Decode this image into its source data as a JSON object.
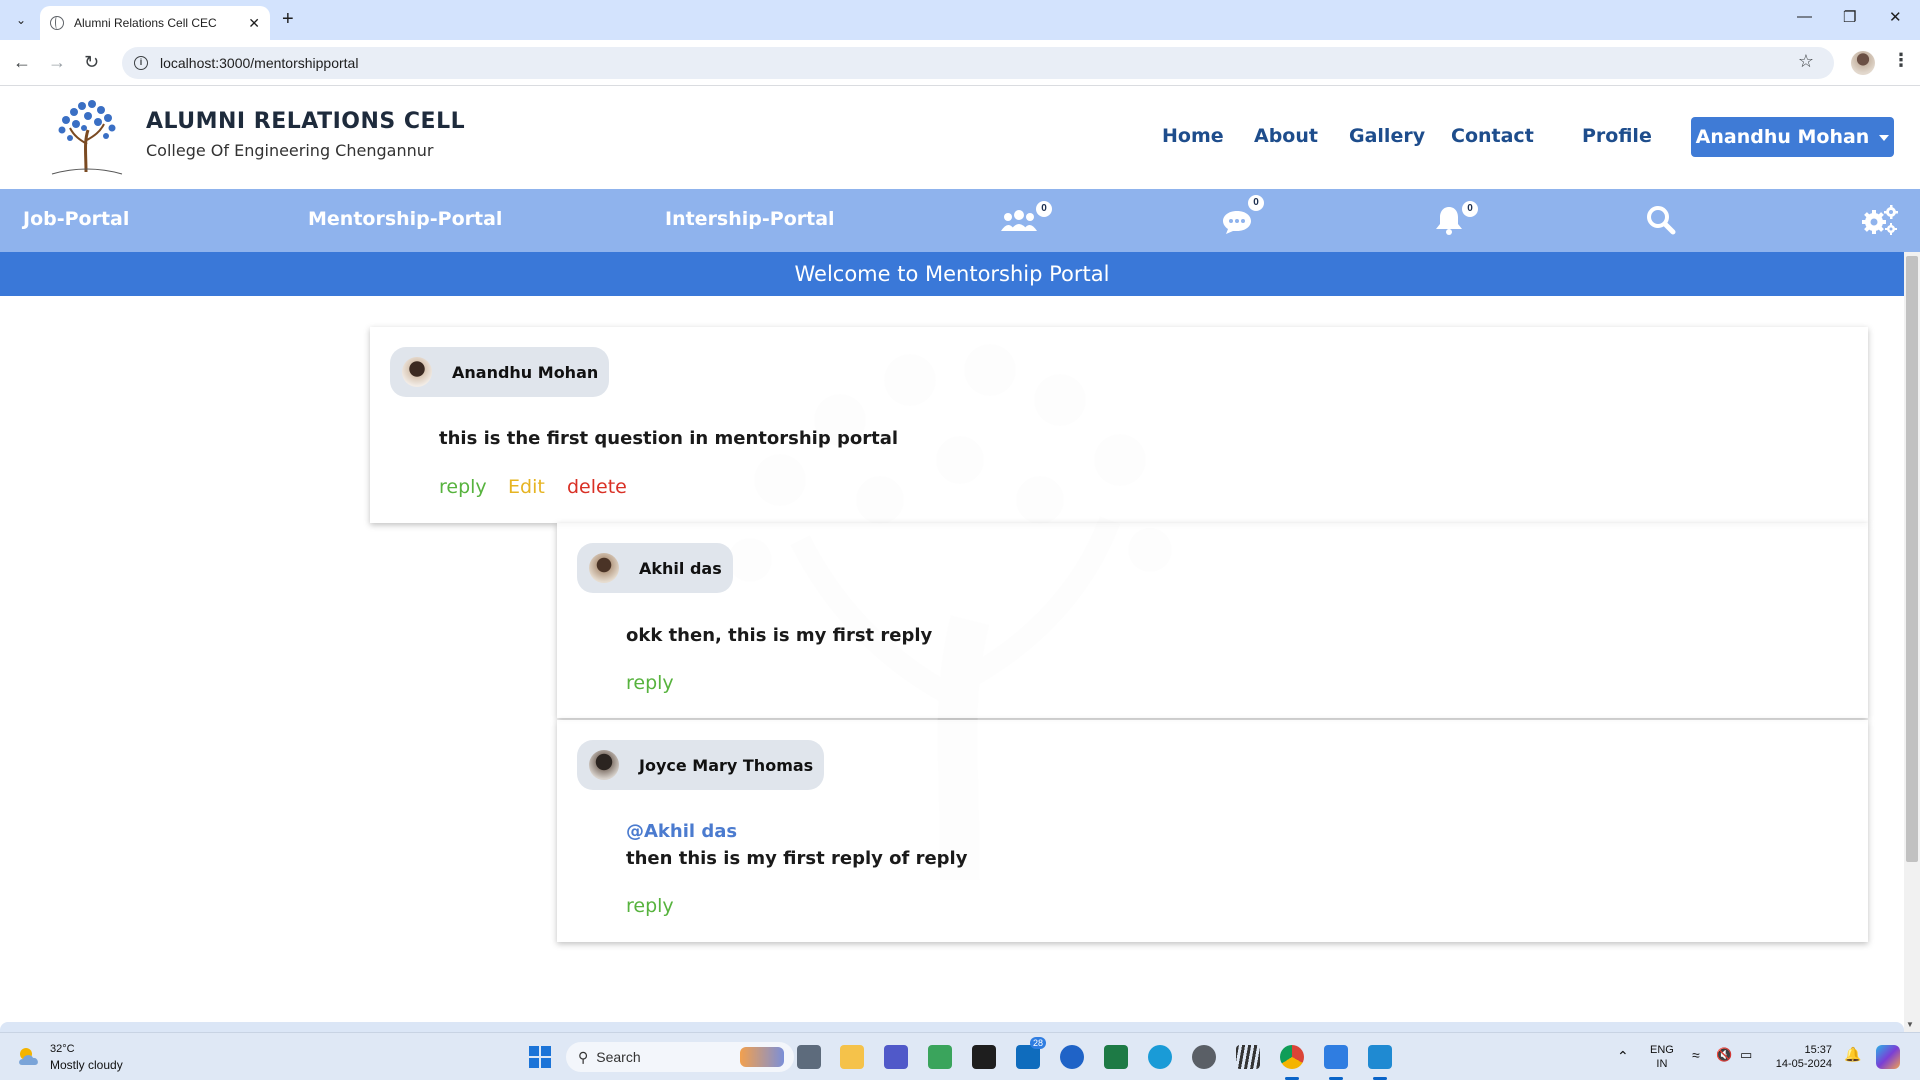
{
  "browser": {
    "tab_title": "Alumni Relations Cell CEC",
    "url": "localhost:3000/mentorshipportal"
  },
  "header": {
    "title": "ALUMNI RELATIONS CELL",
    "subtitle": "College Of Engineering Chengannur",
    "nav": [
      "Home",
      "About",
      "Gallery",
      "Contact",
      "Profile"
    ],
    "user": "Anandhu Mohan"
  },
  "subnav": {
    "links": [
      "Job-Portal",
      "Mentorship-Portal",
      "Intership-Portal"
    ],
    "badges": {
      "groups": "0",
      "messages": "0",
      "notifications": "0"
    }
  },
  "welcome": "Welcome to Mentorship Portal",
  "posts": [
    {
      "author": "Anandhu Mohan",
      "text": "this is the first question in mentorship portal",
      "actions": {
        "reply": "reply",
        "edit": "Edit",
        "delete": "delete"
      }
    },
    {
      "author": "Akhil das",
      "text": "okk then, this is my first reply",
      "actions": {
        "reply": "reply"
      }
    },
    {
      "author": "Joyce Mary Thomas",
      "mention": "@Akhil das",
      "text": "then this is my first reply of reply",
      "actions": {
        "reply": "reply"
      }
    }
  ],
  "taskbar": {
    "temperature": "32°C",
    "weather": "Mostly cloudy",
    "search_placeholder": "Search",
    "mail_badge": "28",
    "lang": "ENG",
    "region": "IN",
    "time": "15:37",
    "date": "14-05-2024"
  },
  "colors": {
    "primary": "#3a78d8",
    "subnav": "#8fb3ed",
    "reply": "#57b33e",
    "edit": "#e6b422",
    "delete": "#d93025"
  }
}
